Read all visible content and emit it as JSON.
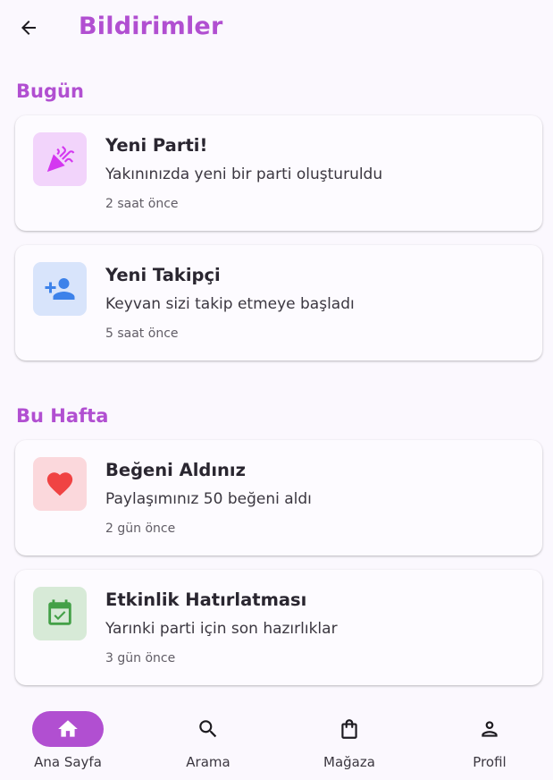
{
  "appbar": {
    "back_icon": "arrow-back-icon",
    "title": "Bildirimler"
  },
  "sections": [
    {
      "title": "Bugün",
      "items": [
        {
          "icon": "party-popper-icon",
          "icon_bg": "#f2d4fb",
          "icon_color": "#d437f0",
          "title": "Yeni Parti!",
          "body": "Yakınınızda yeni bir parti oluşturuldu",
          "time": "2 saat önce"
        },
        {
          "icon": "person-add-icon",
          "icon_bg": "#d8e4fb",
          "icon_color": "#3d82ea",
          "title": "Yeni Takipçi",
          "body": "Keyvan sizi takip etmeye başladı",
          "time": "5 saat önce"
        }
      ]
    },
    {
      "title": "Bu Hafta",
      "items": [
        {
          "icon": "heart-icon",
          "icon_bg": "#fbd8dc",
          "icon_color": "#f04343",
          "title": "Beğeni Aldınız",
          "body": "Paylaşımınız 50 beğeni aldı",
          "time": "2 gün önce"
        },
        {
          "icon": "calendar-check-icon",
          "icon_bg": "#d7ead7",
          "icon_color": "#43a047",
          "title": "Etkinlik Hatırlatması",
          "body": "Yarınki parti için son hazırlıklar",
          "time": "3 gün önce"
        }
      ]
    }
  ],
  "bottom_nav": [
    {
      "icon": "home-icon",
      "label": "Ana Sayfa",
      "active": true
    },
    {
      "icon": "search-icon",
      "label": "Arama",
      "active": false
    },
    {
      "icon": "shopping-bag-icon",
      "label": "Mağaza",
      "active": false
    },
    {
      "icon": "person-icon",
      "label": "Profil",
      "active": false
    }
  ],
  "colors": {
    "accent": "#b14fd1",
    "background": "#fbf8fe"
  }
}
